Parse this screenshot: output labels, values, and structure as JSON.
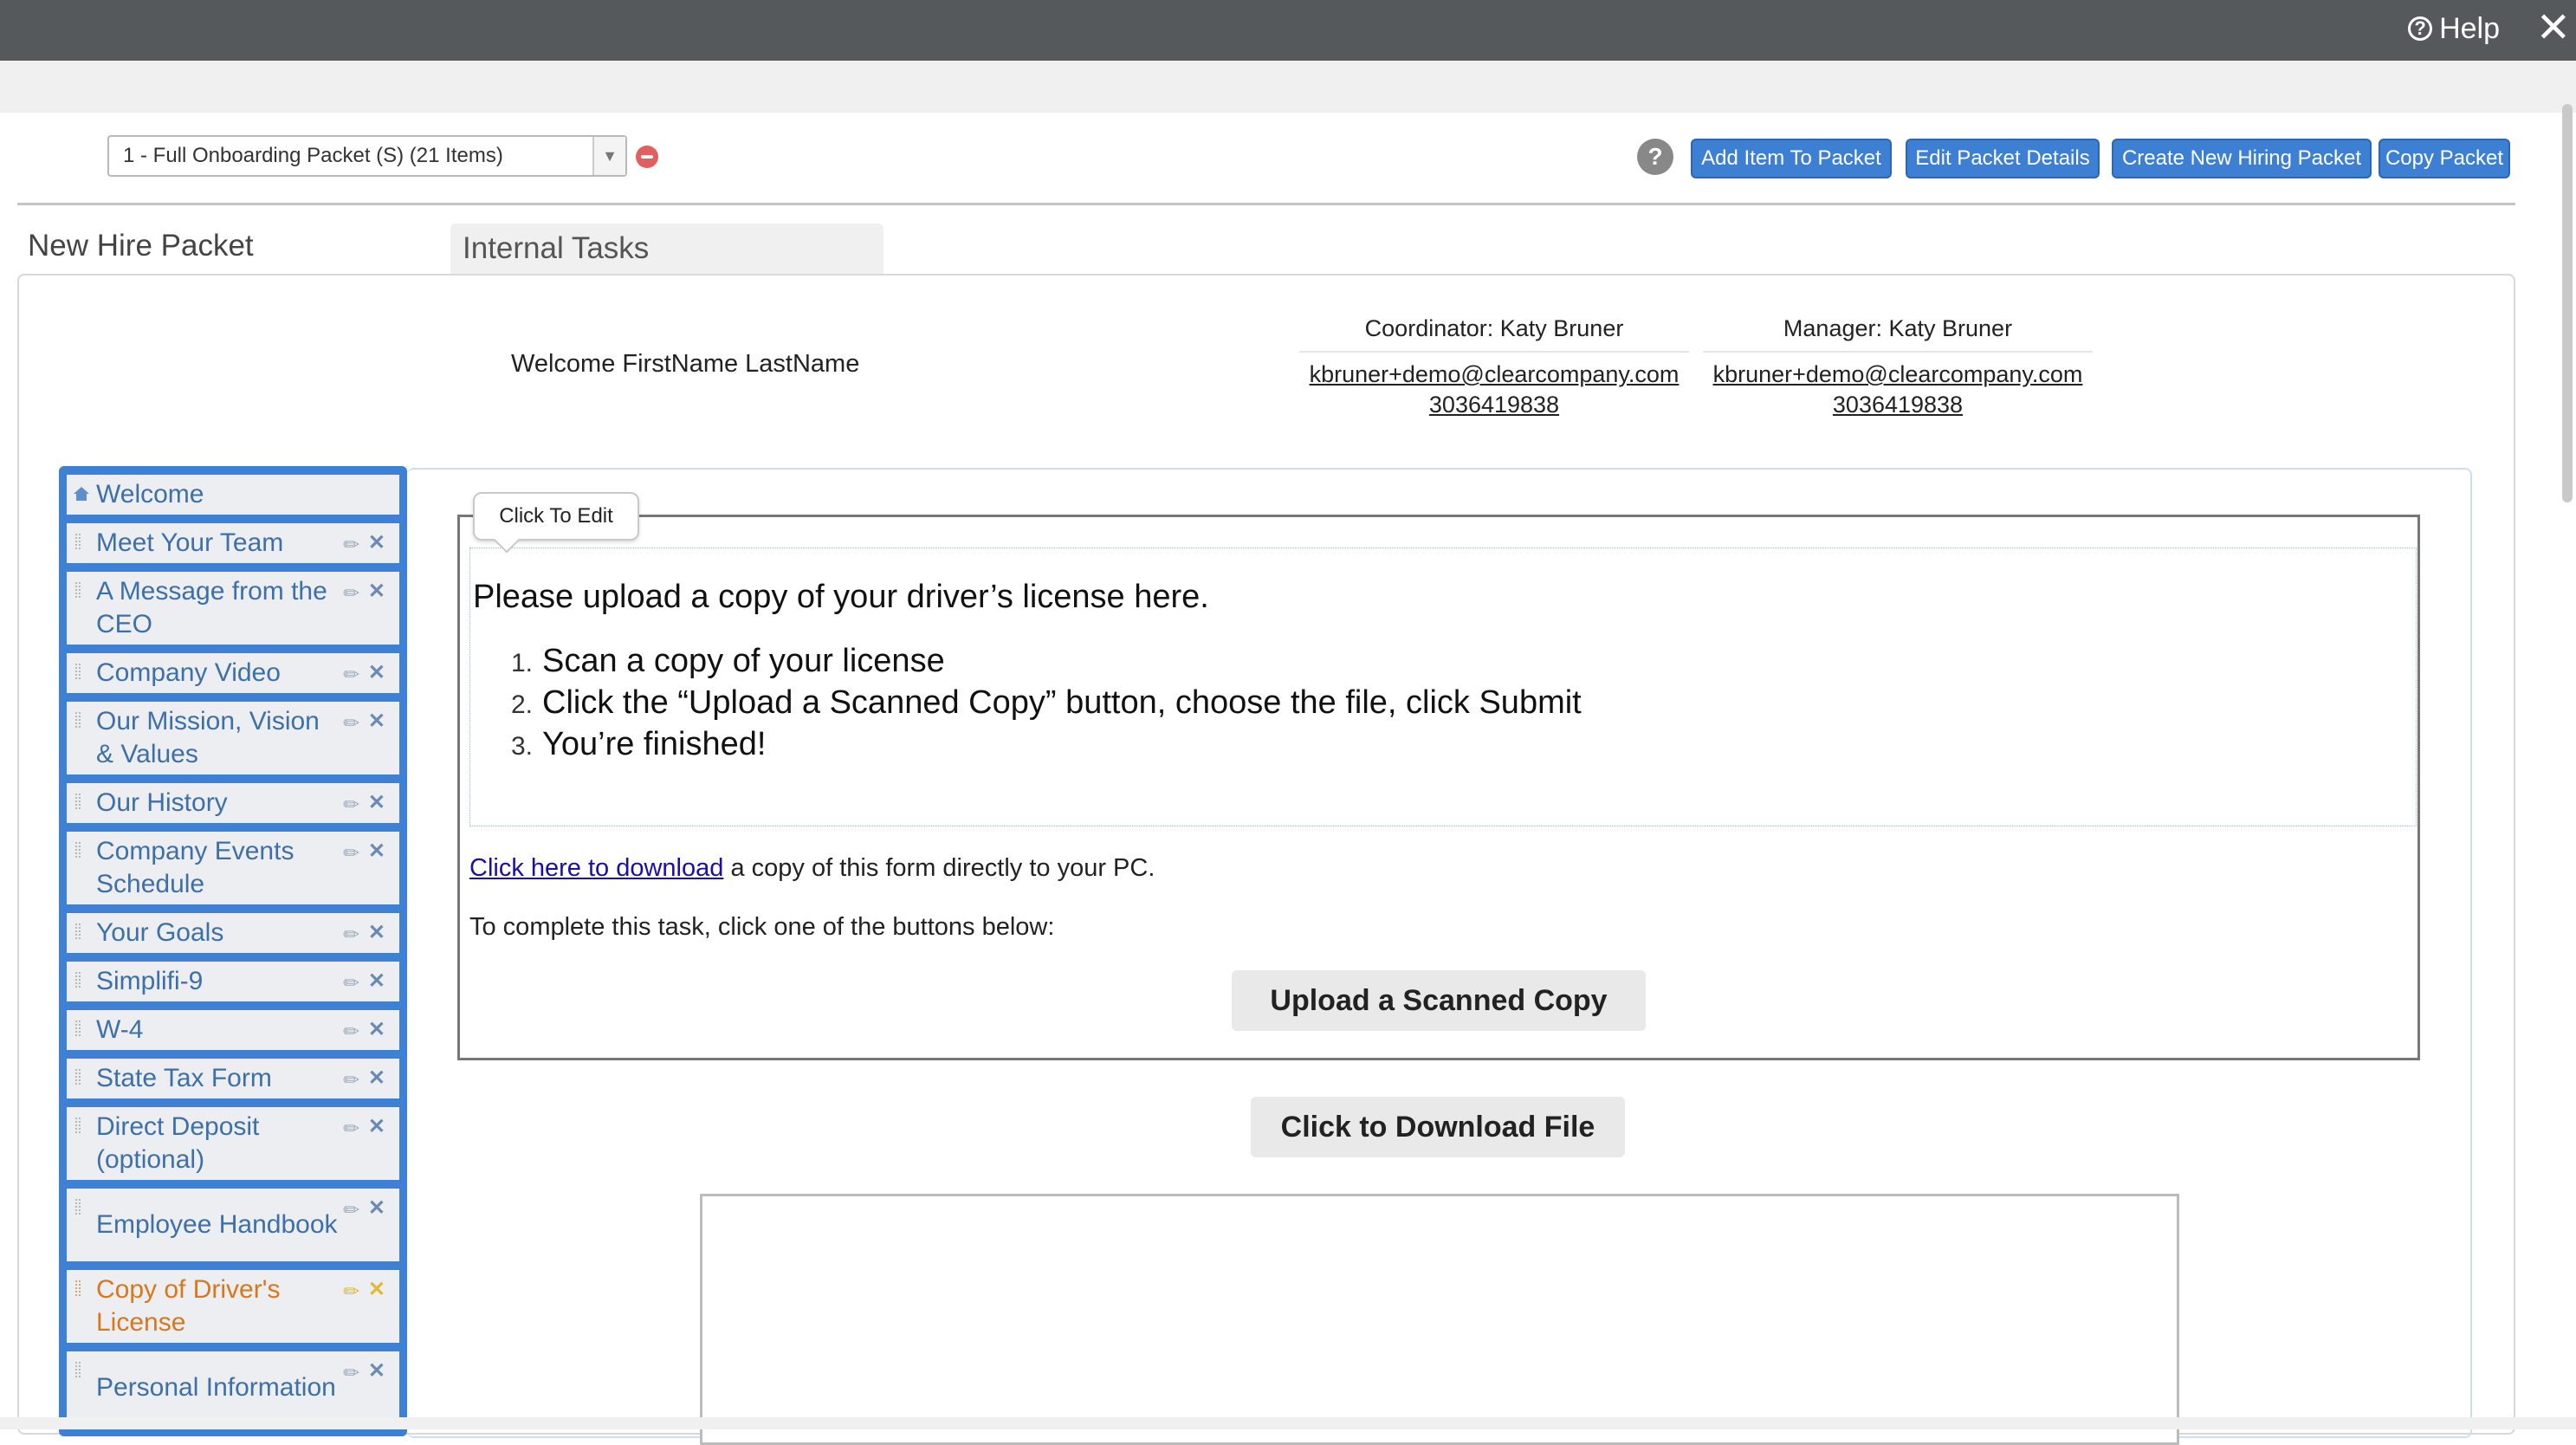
{
  "topbar": {
    "help_label": "Help"
  },
  "packet_select": {
    "selected": "1 - Full Onboarding Packet (S) (21 Items)"
  },
  "toolbar": {
    "help_q": "?",
    "add_item": "Add Item To Packet",
    "edit_details": "Edit Packet Details",
    "create_new": "Create New Hiring Packet",
    "copy_packet": "Copy Packet"
  },
  "tabs": {
    "new_hire": "New Hire Packet",
    "internal": "Internal Tasks"
  },
  "header": {
    "welcome": "Welcome FirstName LastName",
    "coordinator": {
      "role": "Coordinator: Katy Bruner",
      "email": "kbruner+demo@clearcompany.com",
      "phone": "3036419838"
    },
    "manager": {
      "role": "Manager: Katy Bruner",
      "email": "kbruner+demo@clearcompany.com",
      "phone": "3036419838"
    }
  },
  "sidebar": {
    "items": [
      {
        "label": "Welcome"
      },
      {
        "label": "Meet Your Team"
      },
      {
        "label": "A Message from the CEO"
      },
      {
        "label": "Company Video"
      },
      {
        "label": "Our Mission, Vision & Values"
      },
      {
        "label": "Our History"
      },
      {
        "label": "Company Events Schedule"
      },
      {
        "label": "Your Goals"
      },
      {
        "label": "Simplifi-9"
      },
      {
        "label": "W-4"
      },
      {
        "label": "State Tax Form"
      },
      {
        "label": "Direct Deposit (optional)"
      },
      {
        "label": "Employee Handbook"
      },
      {
        "label": "Copy of Driver's License"
      },
      {
        "label": "Personal Information"
      }
    ],
    "active_item": "Copy of Driver's License",
    "active_color": "#d9771b"
  },
  "content": {
    "tooltip": "Click To Edit",
    "heading": "Please upload a copy of your driver’s license here.",
    "steps": [
      {
        "num": "1.",
        "text": "Scan a copy of your license"
      },
      {
        "num": "2.",
        "text": "Click the “Upload a Scanned Copy” button, choose the file, click Submit"
      },
      {
        "num": "3.",
        "text": "You’re finished!"
      }
    ],
    "download_link": "Click here to download",
    "download_rest": " a copy of this form directly to your PC.",
    "complete_text": "To complete this task, click one of the buttons below:",
    "upload_button": "Upload a Scanned Copy",
    "download_file_button": "Click to Download File"
  },
  "colors": {
    "topbar": "#55595c",
    "accent": "#3d7fd3"
  }
}
